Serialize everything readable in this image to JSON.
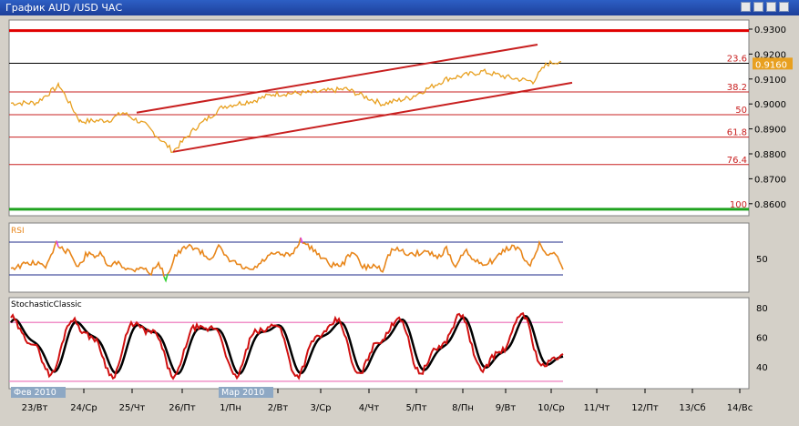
{
  "window": {
    "title": "График AUD /USD  ЧАС",
    "buttons": [
      "menu-icon",
      "minimize-icon",
      "restore-icon",
      "close-icon"
    ]
  },
  "colors": {
    "price": "#e8a020",
    "price_label_bg": "#e8a020",
    "channel": "#c82020",
    "fib": "#c82020",
    "top_line": "#e00000",
    "bottom_line": "#1fa21f",
    "rsi": "#e8861a",
    "rsi_overbought": "#e040e0",
    "rsi_oversold": "#30d030",
    "rsi_levels": "#1c2a8a",
    "stoch_main": "#d01010",
    "stoch_signal": "#000000",
    "stoch_levels": "#f090c8"
  },
  "price_panel": {
    "axis_labels": [
      "0.9300",
      "0.9200",
      "0.9100",
      "0.9000",
      "0.8900",
      "0.8800",
      "0.8700",
      "0.8600"
    ],
    "current_price": "0.9160",
    "fib_levels": [
      {
        "label": "23.6",
        "value": 0.9163
      },
      {
        "label": "38.2",
        "value": 0.9048
      },
      {
        "label": "50",
        "value": 0.8957
      },
      {
        "label": "61.8",
        "value": 0.8867
      },
      {
        "label": "76.4",
        "value": 0.8757
      },
      {
        "label": "100",
        "value": 0.8578
      }
    ],
    "top_level": 0.9294,
    "bottom_level": 0.8578
  },
  "rsi_panel": {
    "label": "RSI",
    "axis_labels": [
      "50"
    ]
  },
  "stoch_panel": {
    "label": "StochasticClassic",
    "axis_labels": [
      "80",
      "60",
      "40"
    ]
  },
  "time_axis": {
    "labels": [
      "23/Вт",
      "24/Ср",
      "25/Чт",
      "26/Пт",
      "1/Пн",
      "2/Вт",
      "3/Ср",
      "4/Чт",
      "5/Пт",
      "8/Пн",
      "9/Вт",
      "10/Ср",
      "11/Чт",
      "12/Пт",
      "13/Сб",
      "14/Вс"
    ],
    "month_labels": [
      "Фев 2010",
      "Мар 2010"
    ]
  }
}
